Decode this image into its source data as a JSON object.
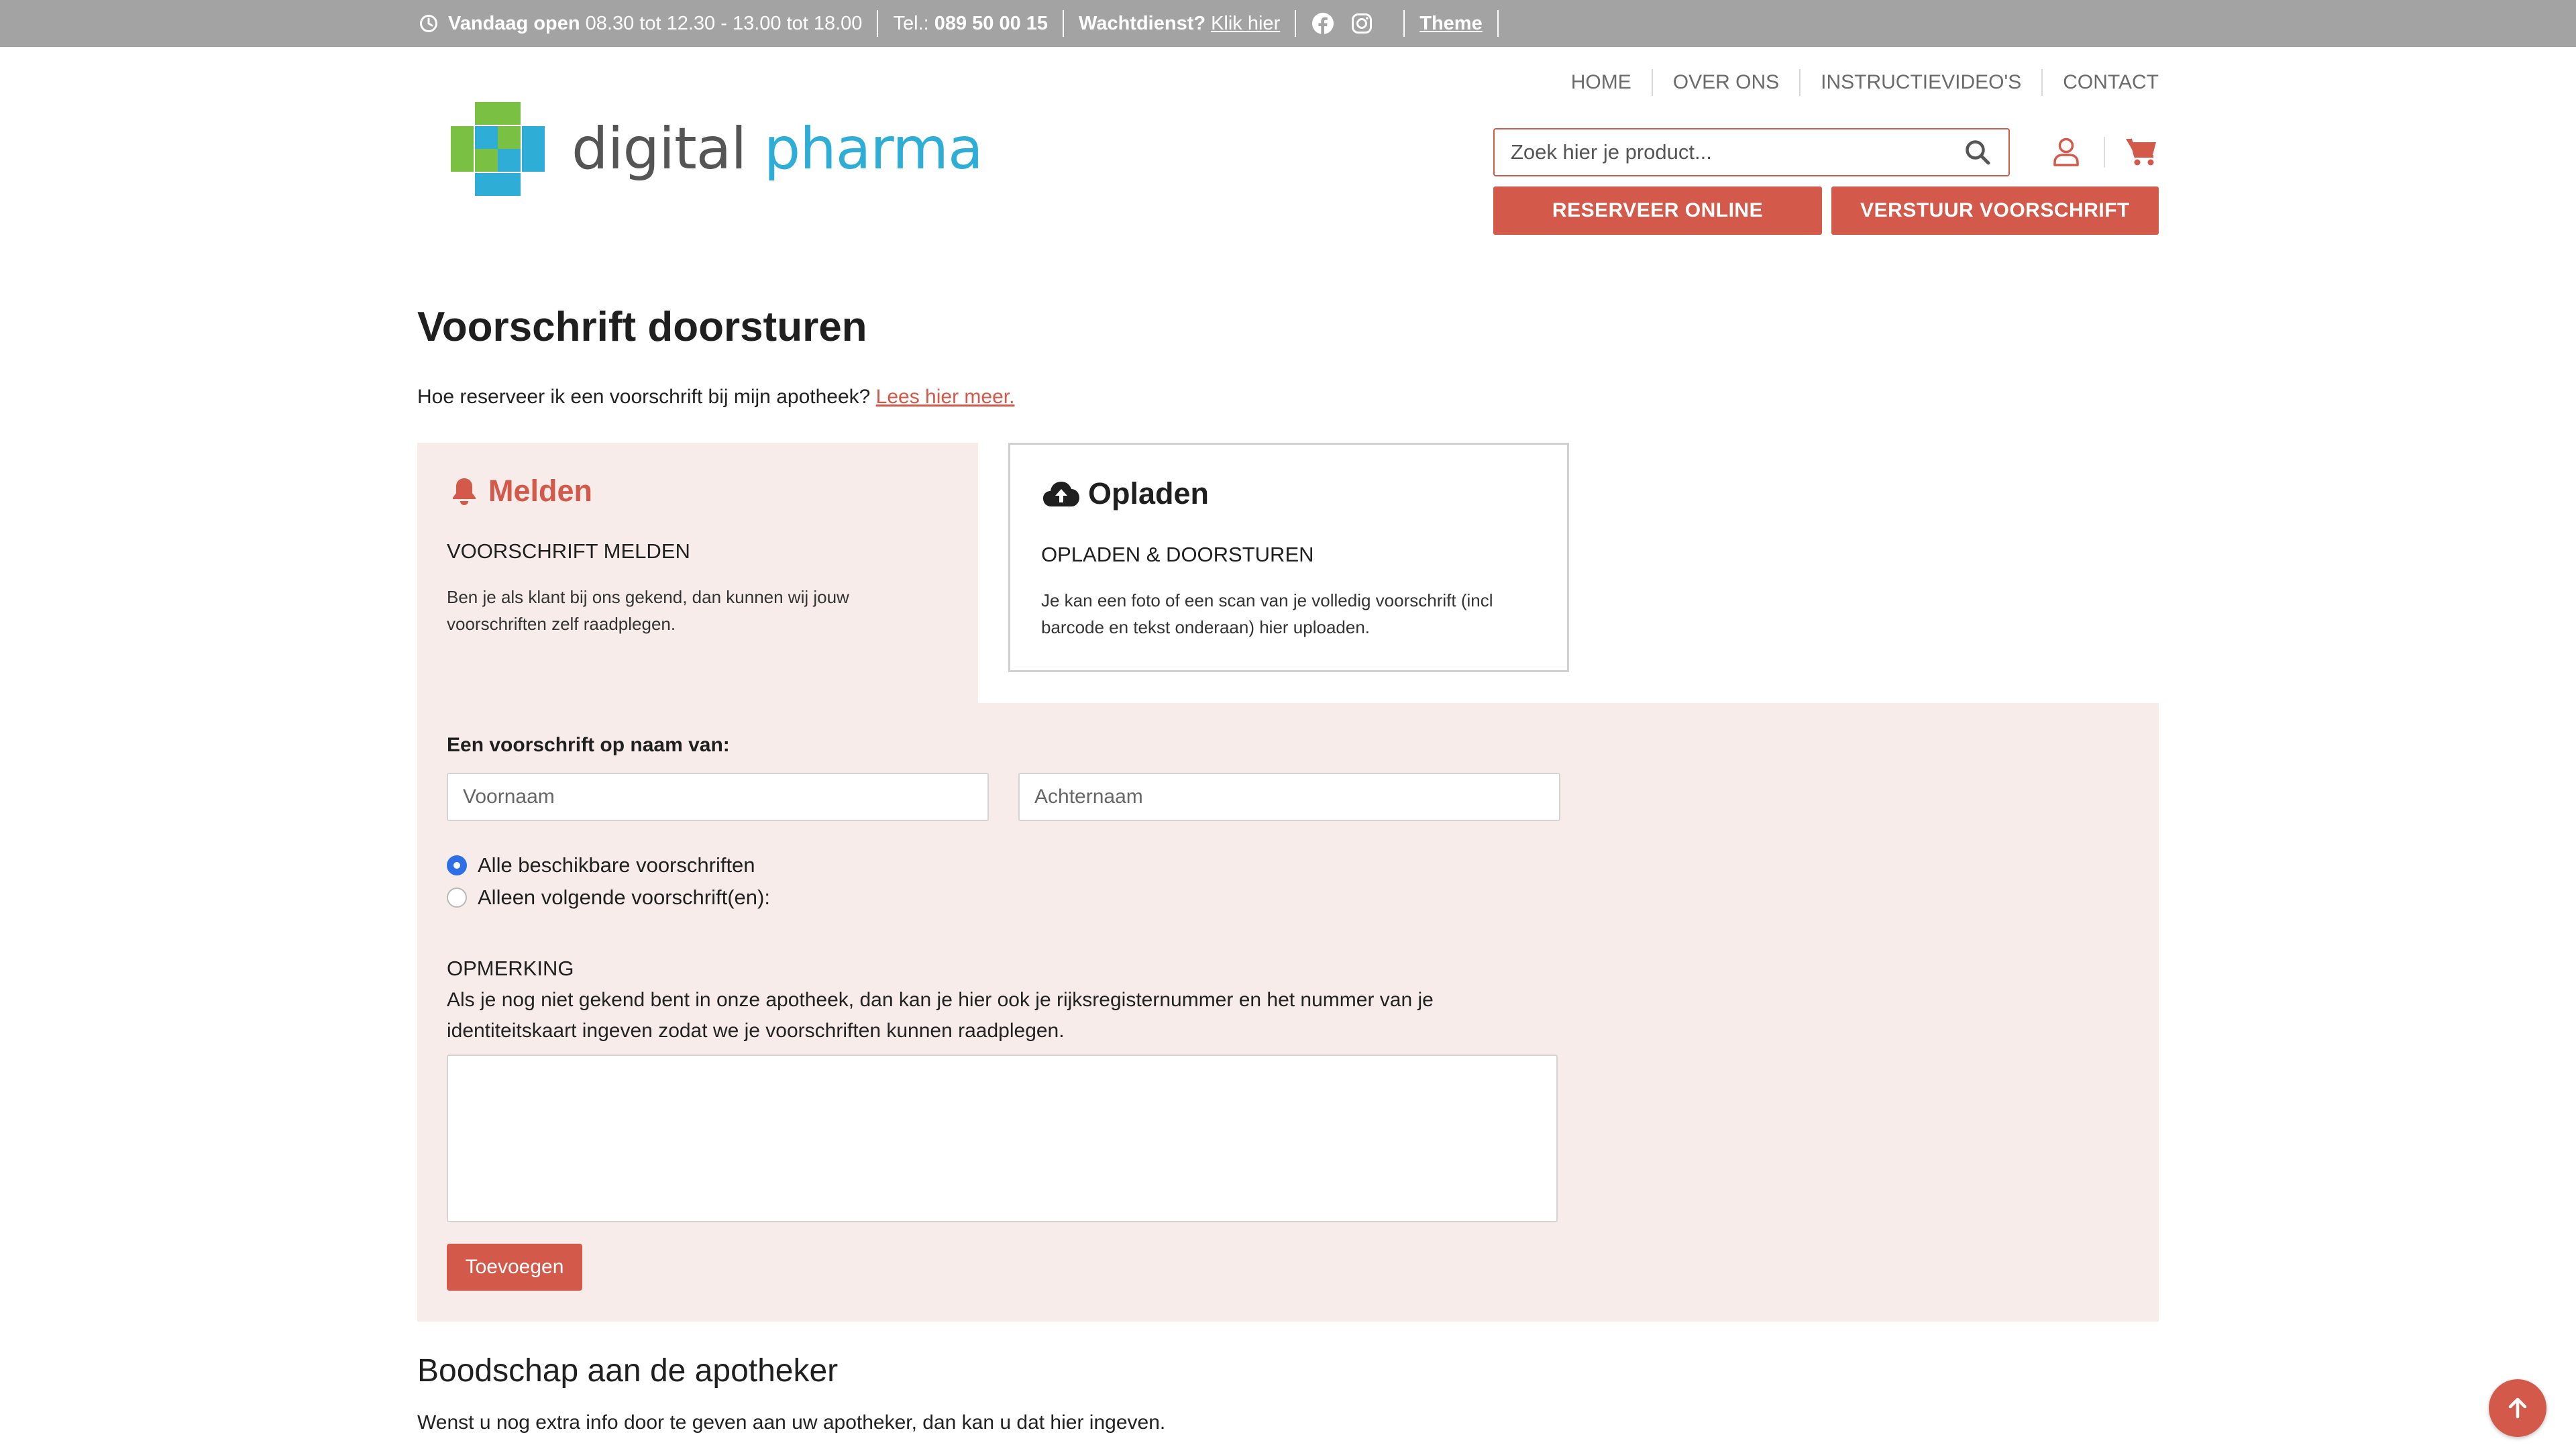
{
  "topbar": {
    "open_label": "Vandaag open",
    "open_hours": "08.30 tot 12.30 - 13.00 tot 18.00",
    "tel_label": "Tel.:",
    "tel_number": "089 50 00 15",
    "wacht_label": "Wachtdienst?",
    "wacht_link": "Klik hier",
    "theme_label": "Theme",
    "icons": [
      "clock-icon",
      "facebook-icon",
      "instagram-icon"
    ]
  },
  "logo": {
    "part1": "digital",
    "part2": "pharma"
  },
  "nav": {
    "items": [
      "HOME",
      "OVER ONS",
      "INSTRUCTIEVIDEO'S",
      "CONTACT"
    ]
  },
  "search": {
    "placeholder": "Zoek hier je product..."
  },
  "header_buttons": {
    "reserve": "RESERVEER ONLINE",
    "send": "VERSTUUR VOORSCHRIFT"
  },
  "page": {
    "title": "Voorschrift doorsturen",
    "intro": "Hoe reserveer ik een voorschrift bij mijn apotheek?",
    "intro_link": "Lees hier meer."
  },
  "tabs": {
    "melden": {
      "title": "Melden",
      "subtitle": "VOORSCHRIFT MELDEN",
      "description": "Ben je als klant bij ons gekend, dan kunnen wij jouw voorschriften zelf raadplegen."
    },
    "opladen": {
      "title": "Opladen",
      "subtitle": "OPLADEN & DOORSTUREN",
      "description": "Je kan een foto of een scan van je volledig voorschrift (incl barcode en tekst onderaan) hier uploaden."
    }
  },
  "form": {
    "name_label": "Een voorschrift op naam van:",
    "first_name_placeholder": "Voornaam",
    "last_name_placeholder": "Achternaam",
    "radio_all": "Alle beschikbare voorschriften",
    "radio_specific": "Alleen volgende voorschrift(en):",
    "remark_title": "OPMERKING",
    "remark_text": "Als je nog niet gekend bent in onze apotheek, dan kan je hier ook je rijksregisternummer en het nummer van je identiteitskaart ingeven zodat we je voorschriften kunnen raadplegen.",
    "add_button": "Toevoegen"
  },
  "message_section": {
    "title": "Boodschap aan de apotheker",
    "text": "Wenst u nog extra info door te geven aan uw apotheker, dan kan u dat hier ingeven."
  },
  "colors": {
    "accent": "#d3594a",
    "topbar": "#a3a3a3",
    "panel": "#f8ecea",
    "logo_green": "#7ac043",
    "logo_blue": "#2eaed6"
  }
}
